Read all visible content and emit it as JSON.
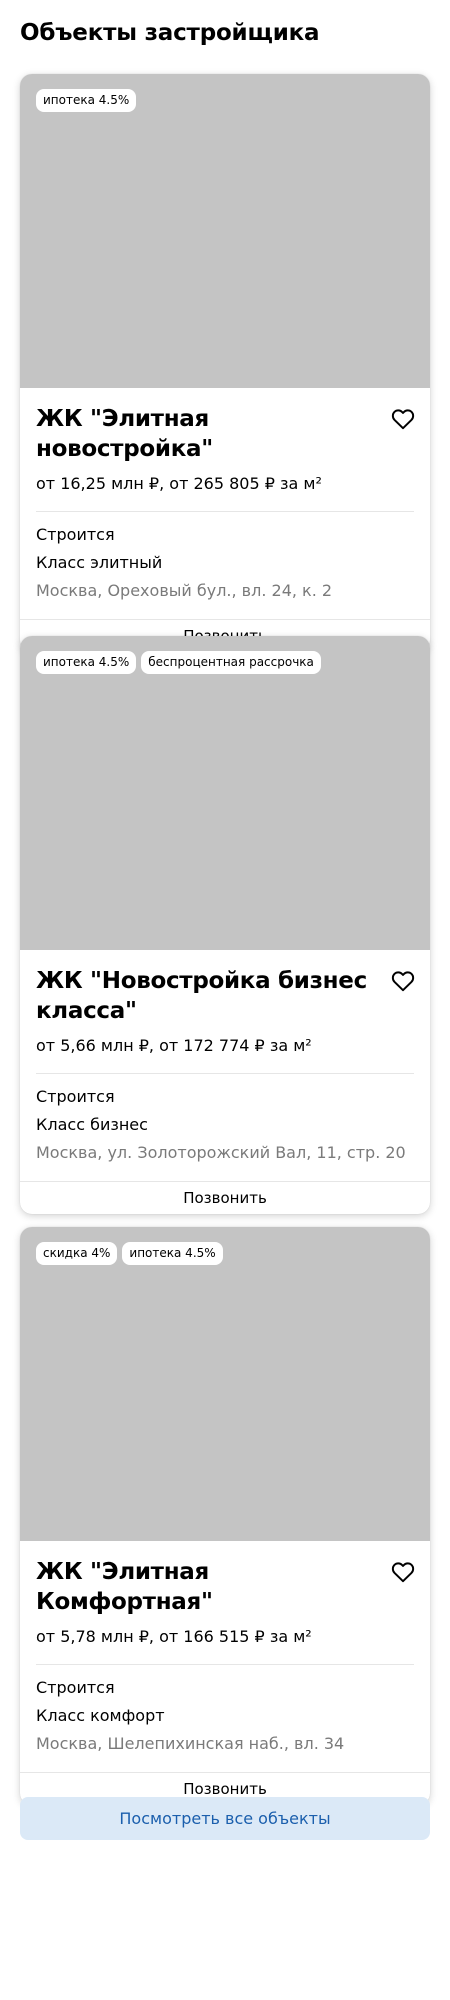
{
  "page_title": "Объекты застройщика",
  "cards": [
    {
      "badges": [
        "ипотека 4.5%"
      ],
      "title": "ЖК \"Элитная новостройка\"",
      "price": "от 16,25 млн ₽, от 265 805 ₽ за м²",
      "status": "Строится",
      "class": "Класс элитный",
      "address": "Москва, Ореховый бул., вл. 24, к. 2",
      "call_label": "Позвонить"
    },
    {
      "badges": [
        "ипотека 4.5%",
        "беспроцентная рассрочка"
      ],
      "title": "ЖК \"Новостройка бизнес класса\"",
      "price": "от 5,66 млн ₽, от 172 774 ₽ за м²",
      "status": "Строится",
      "class": "Класс бизнес",
      "address": "Москва, ул. Золоторожский Вал, 11, стр. 20",
      "call_label": "Позвонить"
    },
    {
      "badges": [
        "скидка 4%",
        "ипотека 4.5%"
      ],
      "title": "ЖК \"Элитная Комфортная\"",
      "price": "от 5,78 млн ₽, от 166 515 ₽ за м²",
      "status": "Строится",
      "class": "Класс комфорт",
      "address": "Москва, Шелепихинская наб., вл. 34",
      "call_label": "Позвонить"
    }
  ],
  "all_objects_label": "Посмотреть все объекты",
  "colors": {
    "image_placeholder": "#c4c4c4",
    "button_bg": "#dbe9f7",
    "button_text": "#1b5fad",
    "address_text": "#7a7a7a"
  },
  "icons": {
    "favorite": "heart-outline-icon"
  }
}
